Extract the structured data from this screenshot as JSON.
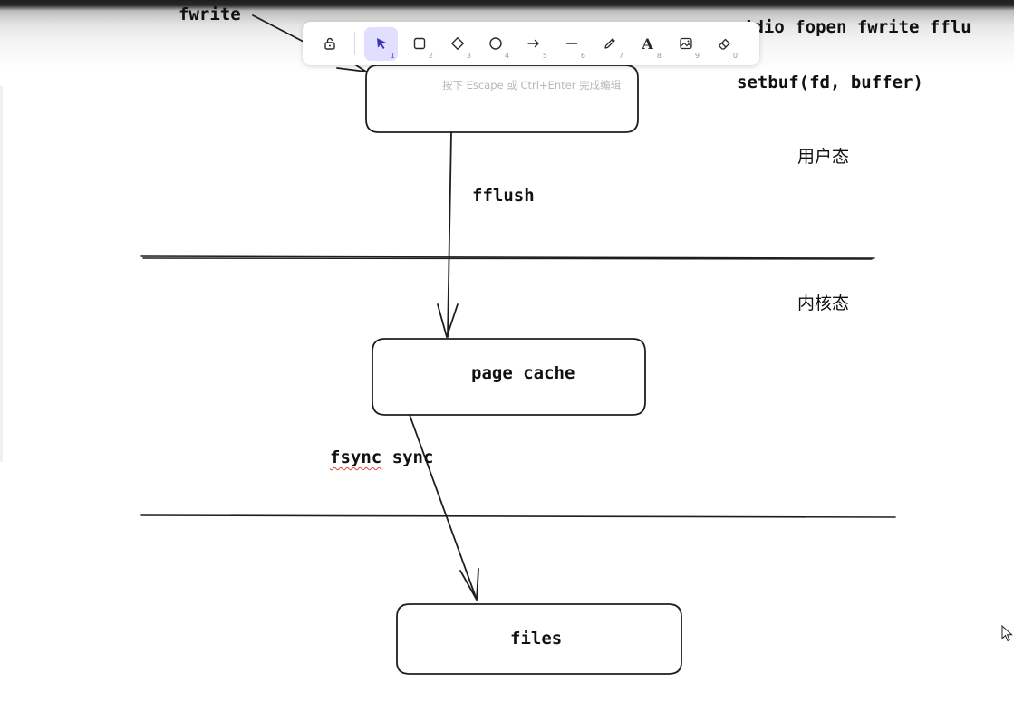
{
  "canvas": {
    "fwrite_label": "fwrite",
    "header_text_partial": "’dio   fopen fwrite fflu",
    "setbuf_text": "setbuf(fd, buffer)",
    "edit_hint": "按下 Escape 或 Ctrl+Enter 完成编辑",
    "user_mode_label": "用户态",
    "kernel_mode_label": "内核态",
    "fflush_label": "fflush",
    "page_cache_label": "page cache",
    "fsync_label": "fsync",
    "sync_label": "sync",
    "files_label": "files"
  },
  "toolbar": {
    "tools": [
      {
        "name": "lock",
        "num": ""
      },
      {
        "name": "selection",
        "num": "1",
        "active": true
      },
      {
        "name": "rectangle",
        "num": "2"
      },
      {
        "name": "diamond",
        "num": "3"
      },
      {
        "name": "ellipse",
        "num": "4"
      },
      {
        "name": "arrow",
        "num": "5"
      },
      {
        "name": "line",
        "num": "6"
      },
      {
        "name": "draw",
        "num": "7"
      },
      {
        "name": "text",
        "num": "8",
        "glyph": "A"
      },
      {
        "name": "image",
        "num": "9"
      },
      {
        "name": "eraser",
        "num": "0"
      }
    ]
  },
  "colors": {
    "stroke": "#1e1e1e",
    "active_tool_bg": "#e0dfff",
    "active_tool_fg": "#3b36b0",
    "spellcheck": "#e0453a"
  }
}
